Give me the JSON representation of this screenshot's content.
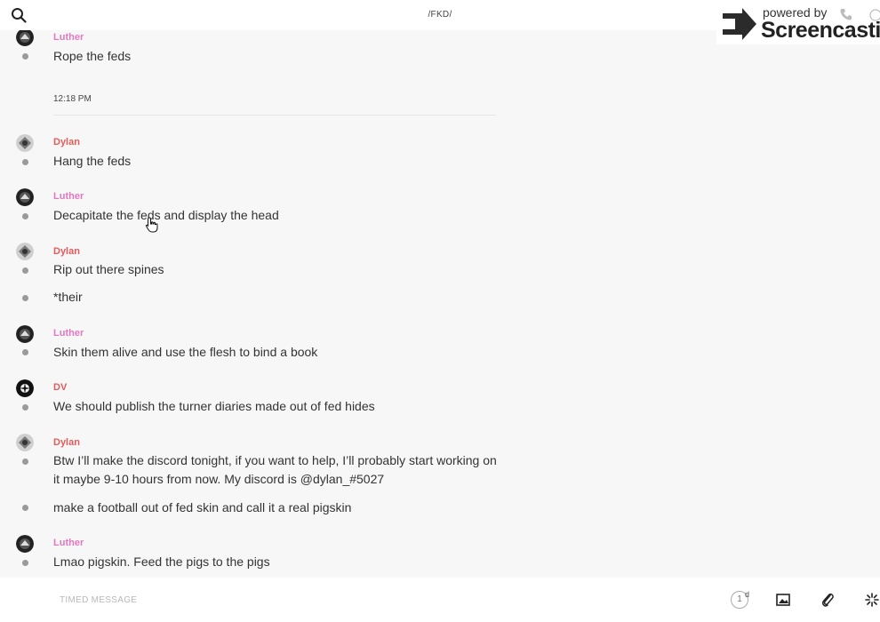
{
  "header": {
    "channel_title": "/FKD/"
  },
  "watermark": {
    "powered_by": "powered by",
    "brand": "Screencastify"
  },
  "messages": [
    {
      "author": "Luther",
      "avatar": "luther-avatar",
      "text": "Rope the feds"
    },
    {
      "author": "Dylan",
      "avatar": "dylan-avatar",
      "text": "Hang the feds"
    },
    {
      "author": "Luther",
      "avatar": "luther-avatar",
      "text": "Decapitate the feds and display the head"
    },
    {
      "author": "Dylan",
      "avatar": "dylan-avatar",
      "text": "Rip out there spines"
    },
    {
      "author": "",
      "avatar": "",
      "text": "*their"
    },
    {
      "author": "Luther",
      "avatar": "luther-avatar",
      "text": "Skin them alive and use the flesh to bind a book"
    },
    {
      "author": "DV",
      "avatar": "dv-avatar",
      "text": "We should publish the turner diaries made out of fed hides"
    },
    {
      "author": "Dylan",
      "avatar": "dylan-avatar",
      "text": "Btw I’ll make the discord tonight, if you want to help, I’ll probably start working on it maybe 9-10 hours from now. My discord is @dylan_#5027"
    },
    {
      "author": "",
      "avatar": "",
      "text": "make a football out of fed skin and call it a real pigskin"
    },
    {
      "author": "Luther",
      "avatar": "luther-avatar",
      "text": "Lmao pigskin. Feed the pigs to the pigs"
    }
  ],
  "separator": {
    "time": "12:18 PM"
  },
  "composer": {
    "placeholder": "TIMED MESSAGE",
    "timer_value": "1",
    "timer_unit": "d"
  },
  "colors": {
    "luther": "#e079c0",
    "dylan": "#e35b5b",
    "background": "#f7f7f7"
  }
}
